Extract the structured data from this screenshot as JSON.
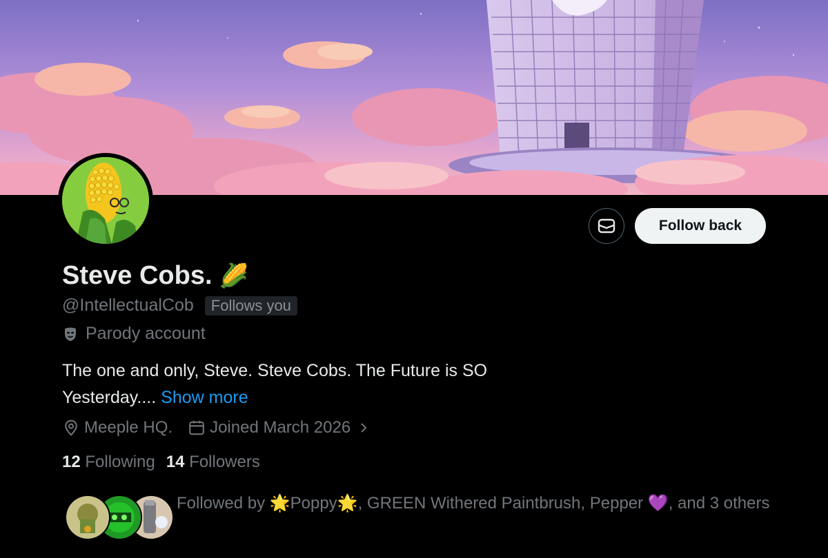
{
  "profile": {
    "display_name": "Steve Cobs.",
    "name_emoji": "🌽",
    "handle": "@IntellectualCob",
    "follows_you_badge": "Follows you",
    "parody_label": "Parody account",
    "bio_text": "The one and only, Steve. Steve Cobs. The Future is SO Yesterday....",
    "show_more": "Show more",
    "location": "Meeple HQ.",
    "joined": "Joined March 2026",
    "following_count": "12",
    "following_label": "Following",
    "followers_count": "14",
    "followers_label": "Followers"
  },
  "actions": {
    "message_icon": "envelope-icon",
    "follow_back_label": "Follow back"
  },
  "followed_by": {
    "prefix": "Followed by",
    "star_emoji": "🌟",
    "name_1": "Poppy",
    "name_2": "GREEN Withered Paintbrush",
    "name_3": "Pepper",
    "heart_emoji": "💜",
    "suffix": ", and 3 others"
  },
  "colors": {
    "background": "#000000",
    "primary_text": "#e7e9ea",
    "secondary_text": "#71767b",
    "link": "#1d9bf0",
    "button_bg": "#eff3f4",
    "button_text": "#0f1419"
  }
}
